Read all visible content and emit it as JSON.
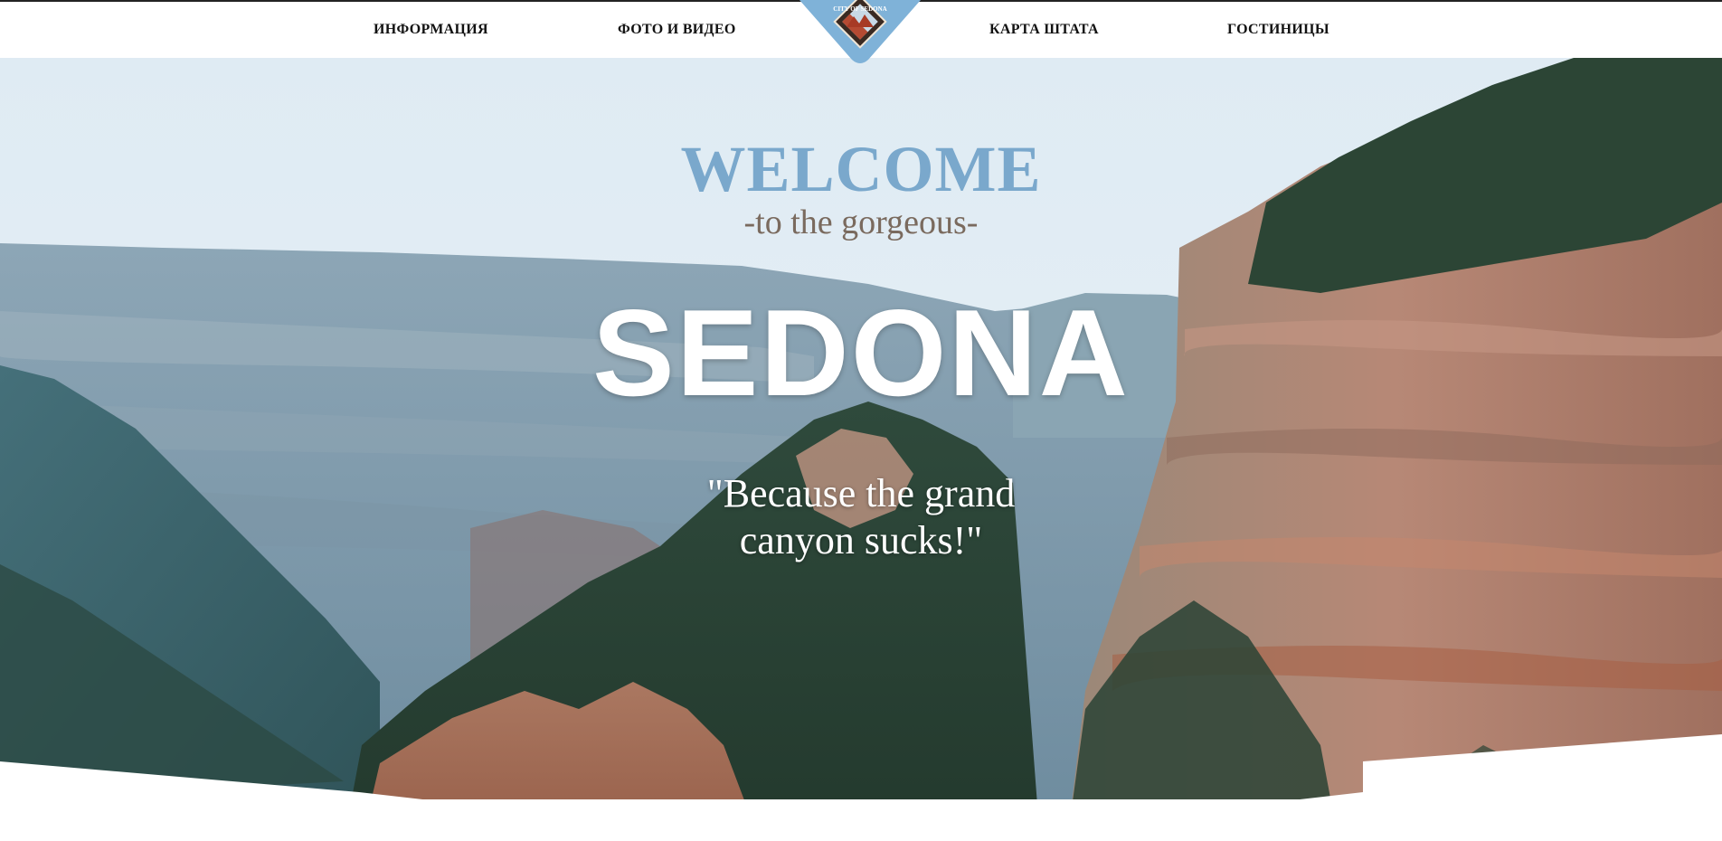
{
  "nav": {
    "items": [
      {
        "label": "ИНФОРМАЦИЯ"
      },
      {
        "label": "ФОТО И ВИДЕО"
      },
      {
        "label": "КАРТА ШТАТА"
      },
      {
        "label": "ГОСТИНИЦЫ"
      }
    ],
    "logo": {
      "text": "CITY OF SEDONA"
    }
  },
  "hero": {
    "welcome": "WELCOME",
    "subtitle": "-to the gorgeous-",
    "title": "SEDONA",
    "quote_line1": "\"Because the grand",
    "quote_line2": "canyon sucks!\""
  },
  "colors": {
    "welcome": "#7aa8cc",
    "subtitle": "#7a6a5e",
    "logo_blue": "#7fb2d8",
    "sky": "#e2eef6"
  }
}
